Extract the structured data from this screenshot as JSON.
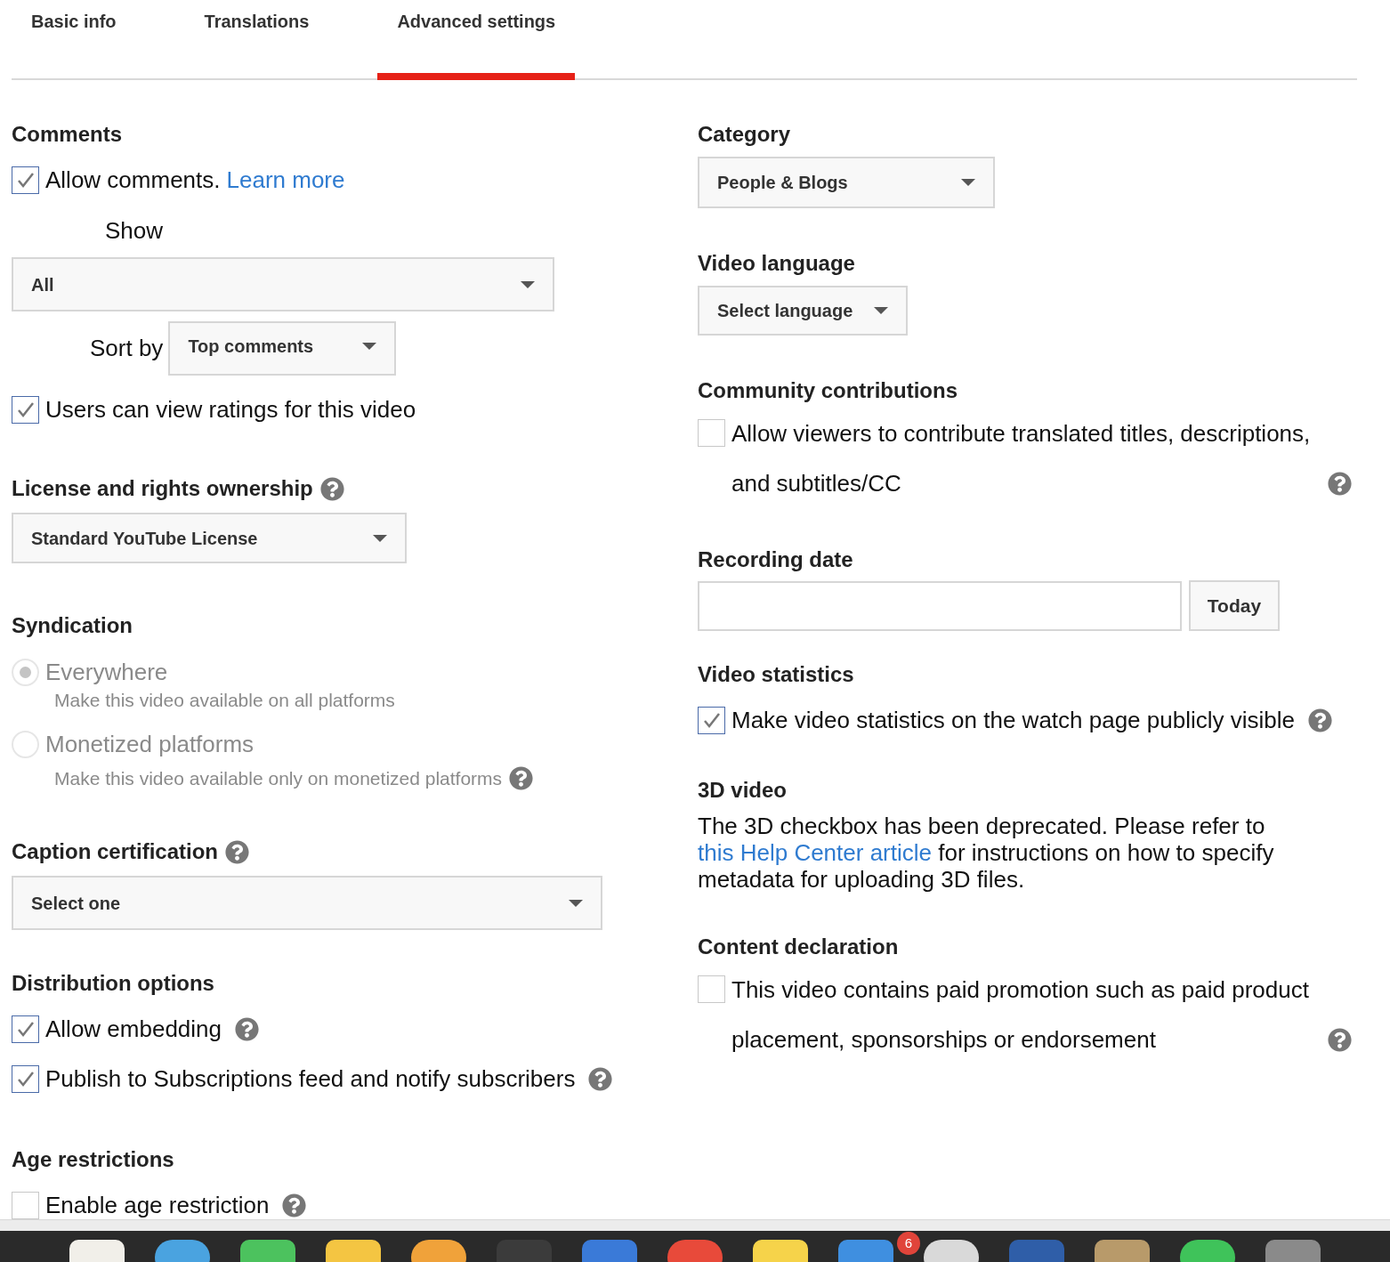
{
  "tabs": [
    {
      "label": "Basic info",
      "selected": false
    },
    {
      "label": "Translations",
      "selected": false
    },
    {
      "label": "Advanced settings",
      "selected": true
    }
  ],
  "comments": {
    "heading": "Comments",
    "allow": {
      "label": "Allow comments.",
      "link": "Learn more",
      "checked": true
    },
    "show_label": "Show",
    "show_value": "All",
    "sort_label": "Sort by",
    "sort_value": "Top comments",
    "ratings": {
      "label": "Users can view ratings for this video",
      "checked": true
    }
  },
  "license": {
    "heading": "License and rights ownership",
    "help": true,
    "value": "Standard YouTube License"
  },
  "syndication": {
    "heading": "Syndication",
    "disabled": true,
    "options": [
      {
        "label": "Everywhere",
        "description": "Make this video available on all platforms",
        "selected": true
      },
      {
        "label": "Monetized platforms",
        "description": "Make this video available only on monetized platforms",
        "selected": false,
        "help": true
      }
    ]
  },
  "caption": {
    "heading": "Caption certification",
    "help": true,
    "value": "Select one"
  },
  "distribution": {
    "heading": "Distribution options",
    "options": [
      {
        "label": "Allow embedding",
        "checked": true,
        "help": true
      },
      {
        "label": "Publish to Subscriptions feed and notify subscribers",
        "checked": true,
        "help": true
      }
    ]
  },
  "age": {
    "heading": "Age restrictions",
    "option": {
      "label": "Enable age restriction",
      "checked": false,
      "help": true
    }
  },
  "category": {
    "heading": "Category",
    "value": "People & Blogs"
  },
  "video_language": {
    "heading": "Video language",
    "value": "Select language"
  },
  "community": {
    "heading": "Community contributions",
    "option": {
      "label": "Allow viewers to contribute translated titles, descriptions, and subtitles/CC",
      "checked": false,
      "help": true
    }
  },
  "recording_date": {
    "heading": "Recording date",
    "button": "Today"
  },
  "video_statistics": {
    "heading": "Video statistics",
    "option": {
      "label": "Make video statistics on the watch page publicly visible",
      "checked": true,
      "help": true
    }
  },
  "three_d": {
    "heading": "3D video",
    "before": "The 3D checkbox has been deprecated. Please refer to",
    "link": "this Help Center article",
    "after": "for instructions on how to specify metadata for uploading 3D files."
  },
  "content_declaration": {
    "heading": "Content declaration",
    "option": {
      "label": "This video contains paid promotion such as paid product placement, sponsorships or endorsement",
      "checked": false,
      "help": true
    }
  },
  "dock": {
    "badge": "6"
  }
}
